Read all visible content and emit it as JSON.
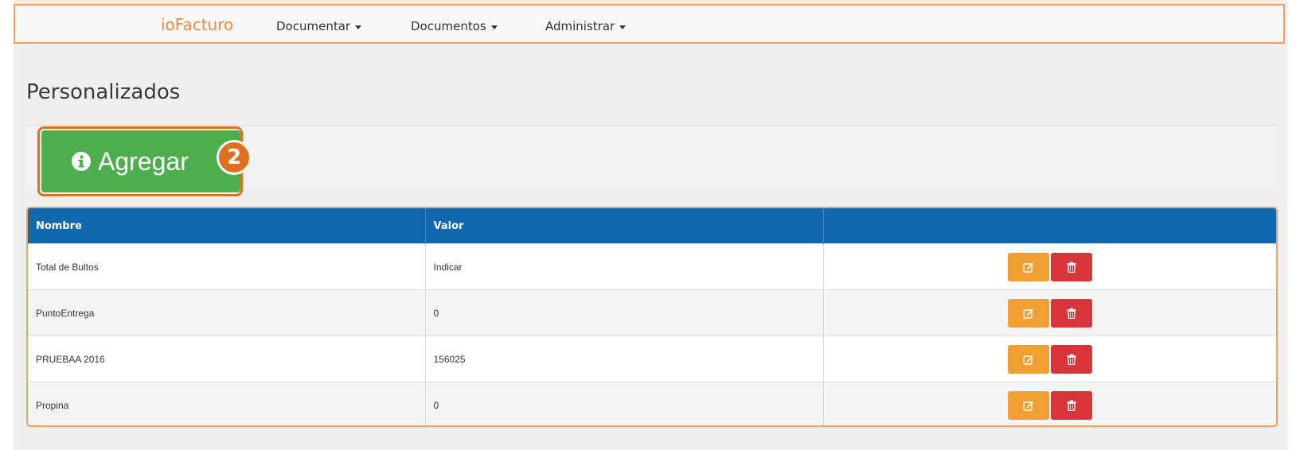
{
  "navbar": {
    "brand": "ioFacturo",
    "menus": [
      {
        "label": "Documentar"
      },
      {
        "label": "Documentos"
      },
      {
        "label": "Administrar"
      }
    ]
  },
  "page": {
    "title": "Personalizados"
  },
  "add_button": {
    "label": "Agregar",
    "icon": "info-circle-icon",
    "step_badge": "2"
  },
  "table": {
    "columns": [
      "Nombre",
      "Valor",
      ""
    ],
    "rows": [
      {
        "nombre": "Total de Bultos",
        "valor": "Indicar"
      },
      {
        "nombre": "PuntoEntrega",
        "valor": "0"
      },
      {
        "nombre": "PRUEBAA 2016",
        "valor": "156025"
      },
      {
        "nombre": "Propina",
        "valor": "0"
      }
    ],
    "row_actions": [
      "edit-icon",
      "trash-icon"
    ]
  },
  "colors": {
    "accent": "#ee8a3c",
    "header_blue": "#1068b0",
    "add_green": "#4cae4c",
    "edit_orange": "#f0a030",
    "delete_red": "#d9343a"
  }
}
